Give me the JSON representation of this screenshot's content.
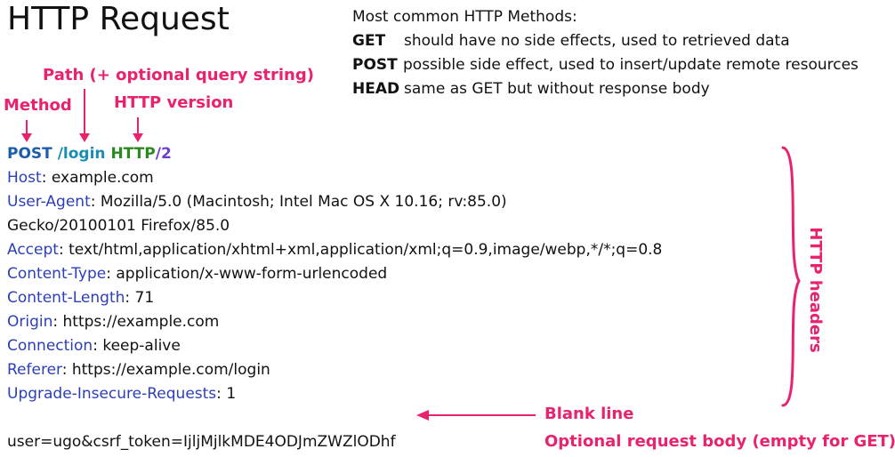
{
  "title": "HTTP Request",
  "methods": {
    "heading": "Most common HTTP Methods:",
    "items": [
      {
        "name": "GET",
        "desc": "should have no side effects, used to retrieved data"
      },
      {
        "name": "POST",
        "desc": "possible side effect, used to insert/update remote resources"
      },
      {
        "name": "HEAD",
        "desc": "same as GET but without response body"
      }
    ]
  },
  "annotations": {
    "method": "Method",
    "path": "Path (+ optional query string)",
    "version": "HTTP version",
    "headers": "HTTP headers",
    "blank_line": "Blank line",
    "body": "Optional request body (empty for GET)"
  },
  "request_line": {
    "method": "POST",
    "path": "/login",
    "protocol": "HTTP",
    "slash": "/",
    "version": "2"
  },
  "headers": [
    {
      "key": "Host",
      "value": "example.com"
    },
    {
      "key": "User-Agent",
      "value": "Mozilla/5.0 (Macintosh; Intel Mac OS X 10.16; rv:85.0)"
    },
    {
      "key": "",
      "value": "Gecko/20100101 Firefox/85.0"
    },
    {
      "key": "Accept",
      "value": "text/html,application/xhtml+xml,application/xml;q=0.9,image/webp,*/*;q=0.8"
    },
    {
      "key": "Content-Type",
      "value": "application/x-www-form-urlencoded"
    },
    {
      "key": "Content-Length",
      "value": "71"
    },
    {
      "key": "Origin",
      "value": "https://example.com"
    },
    {
      "key": "Connection",
      "value": "keep-alive"
    },
    {
      "key": "Referer",
      "value": "https://example.com/login"
    },
    {
      "key": "Upgrade-Insecure-Requests",
      "value": "1"
    }
  ],
  "body_text": "user=ugo&csrf_token=IjljMjlkMDE4ODJmZWZlODhf",
  "colors": {
    "annotation": "#e8226e",
    "method": "#1a5fa8",
    "path": "#1a8db5",
    "protocol": "#2a8a1e",
    "version": "#6d3fcf",
    "header_key": "#2b3fb8"
  }
}
